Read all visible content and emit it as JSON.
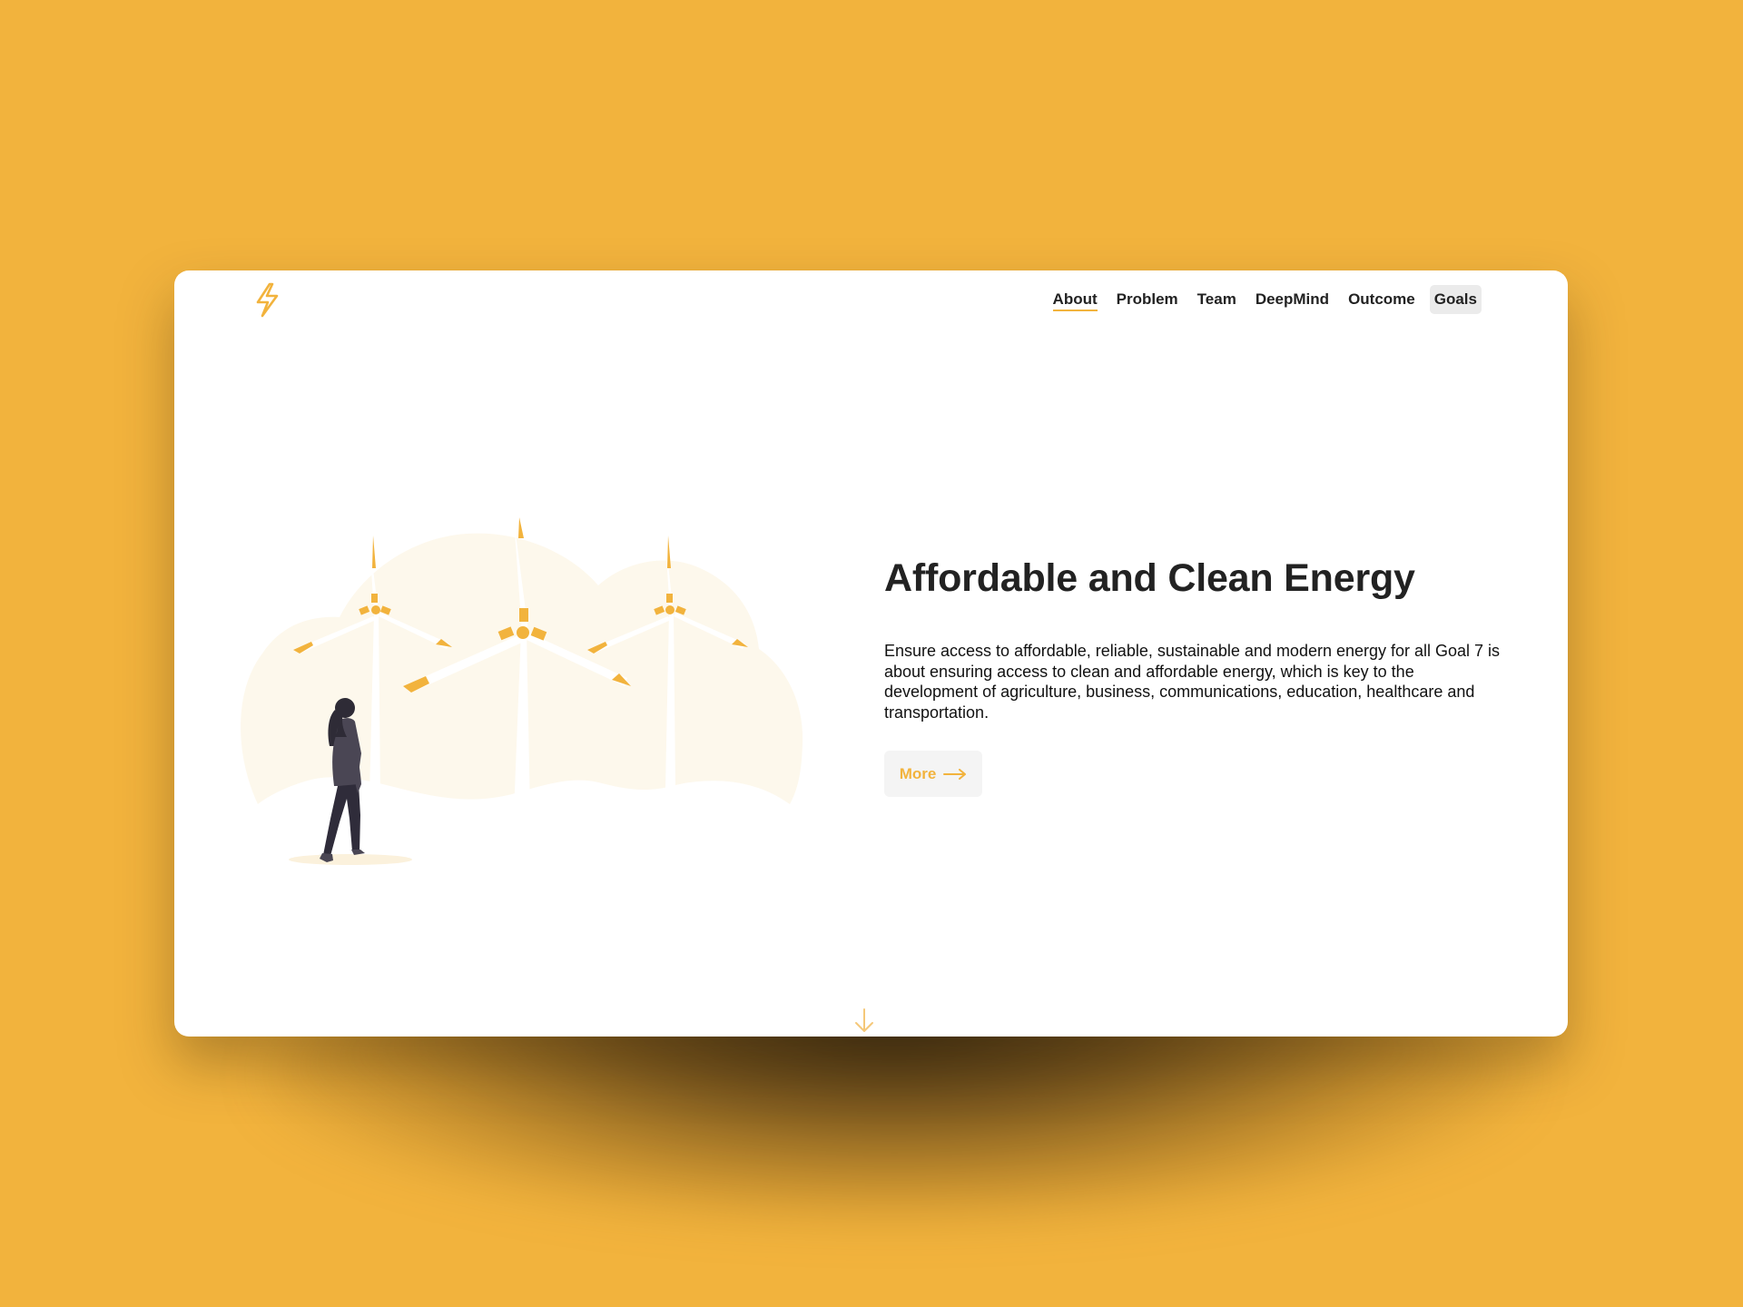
{
  "theme": {
    "accent": "#F2B33D",
    "background": "#F2B33D",
    "card": "#FFFFFF",
    "text": "#222222",
    "figure": "#4A4654"
  },
  "header": {
    "logo_icon": "lightning-bolt-icon",
    "nav": [
      {
        "label": "About",
        "state": "active"
      },
      {
        "label": "Problem",
        "state": "default"
      },
      {
        "label": "Team",
        "state": "default"
      },
      {
        "label": "DeepMind",
        "state": "default"
      },
      {
        "label": "Outcome",
        "state": "default"
      },
      {
        "label": "Goals",
        "state": "boxed"
      }
    ]
  },
  "hero": {
    "illustration": "wind-turbines-with-person-illustration",
    "title": "Affordable and Clean Energy",
    "description": "Ensure access to affordable, reliable, sustainable and modern energy for all Goal 7 is about ensuring access to clean and affordable energy, which is key to the development of agriculture, business, communications, education, healthcare and transportation.",
    "cta": {
      "label": "More",
      "icon": "arrow-right-icon"
    }
  },
  "footer": {
    "scroll_icon": "arrow-down-icon"
  }
}
